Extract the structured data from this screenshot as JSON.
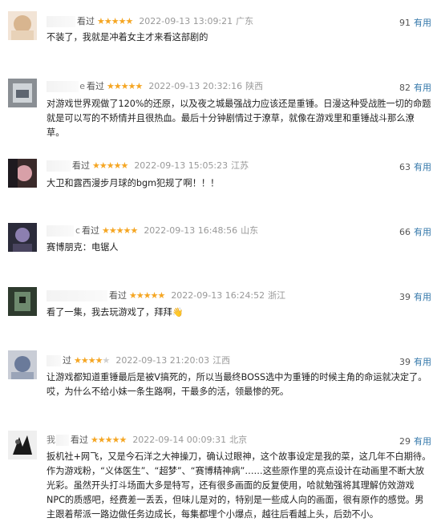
{
  "reviews": [
    {
      "username": "",
      "watched_label": "看过",
      "rating": 5,
      "time": "2022-09-13 13:09:21",
      "location": "广东",
      "votes": "91",
      "useful_label": "有用",
      "content": "不装了，我就是冲着女主才来看这部剧的",
      "colors": {
        "avatar_bg": "#f2e4d6",
        "avatar_fg": "#d8b58f"
      }
    },
    {
      "username": "e",
      "watched_label": "看过",
      "rating": 5,
      "time": "2022-09-13 20:32:16",
      "location": "陕西",
      "votes": "82",
      "useful_label": "有用",
      "content": "对游戏世界观做了120%的还原，以及夜之城最强战力应该还是重锤。日漫这种受战胜一切的命题就是可以写的不矫情并且很热血。最后十分钟剧情过于潦草，就像在游戏里和重锤战斗那么潦草。",
      "colors": {
        "avatar_bg": "#8a8f94",
        "avatar_fg": "#cfd4d8"
      }
    },
    {
      "username": "",
      "watched_label": "看过",
      "rating": 5,
      "time": "2022-09-13 15:05:23",
      "location": "江苏",
      "votes": "63",
      "useful_label": "有用",
      "content": "大卫和露西漫步月球的bgm犯规了啊！！！",
      "colors": {
        "avatar_bg": "#3a2a2a",
        "avatar_fg": "#d8a0a8"
      }
    },
    {
      "username": "c",
      "watched_label": "看过",
      "rating": 5,
      "time": "2022-09-13 16:48:56",
      "location": "山东",
      "votes": "66",
      "useful_label": "有用",
      "content": "赛博朋克：电锯人",
      "colors": {
        "avatar_bg": "#2b2b3a",
        "avatar_fg": "#8c7fb0"
      }
    },
    {
      "username": "",
      "watched_label": "看过",
      "rating": 5,
      "time": "2022-09-13 16:24:52",
      "location": "浙江",
      "votes": "39",
      "useful_label": "有用",
      "content": "看了一集，我去玩游戏了，拜拜👋",
      "colors": {
        "avatar_bg": "#2e3b2e",
        "avatar_fg": "#6e8a6e"
      }
    },
    {
      "username": "",
      "watched_label": "过",
      "rating": 4,
      "time": "2022-09-13 21:20:03",
      "location": "江西",
      "votes": "39",
      "useful_label": "有用",
      "content": "让游戏都知道重锤最后是被V搞死的，所以当最终BOSS选中为重锤的时候主角的命运就决定了。哎，为什么不给小妹一条生路啊，干最多的活，领最惨的死。",
      "colors": {
        "avatar_bg": "#c9cdd6",
        "avatar_fg": "#6a7a9a"
      }
    },
    {
      "username": "我",
      "watched_label": "看过",
      "rating": 5,
      "time": "2022-09-14 00:09:31",
      "location": "北京",
      "votes": "29",
      "useful_label": "有用",
      "content": "扳机社+网飞，又是今石洋之大神操刀，确认过眼神，这个故事设定是我的菜，这几年不白期待。作为游戏粉，“义体医生”、“超梦”、“赛博精神病”……这些原作里的亮点设计在动画里不断大放光彩。虽然开头打斗场面大多是特写，还有很多画面的反复使用，哈就勉强将其理解仿效游戏NPC的质感吧，经费差一丢丢，但味儿是对的，特别是一些成人向的画面，很有原作的感觉。男主跟着帮派一路边做任务边成长，每集都埋个小爆点，越往后看越上头，后劲不小。",
      "colors": {
        "avatar_bg": "#efefef",
        "avatar_fg": "#1a1a1a"
      }
    }
  ]
}
